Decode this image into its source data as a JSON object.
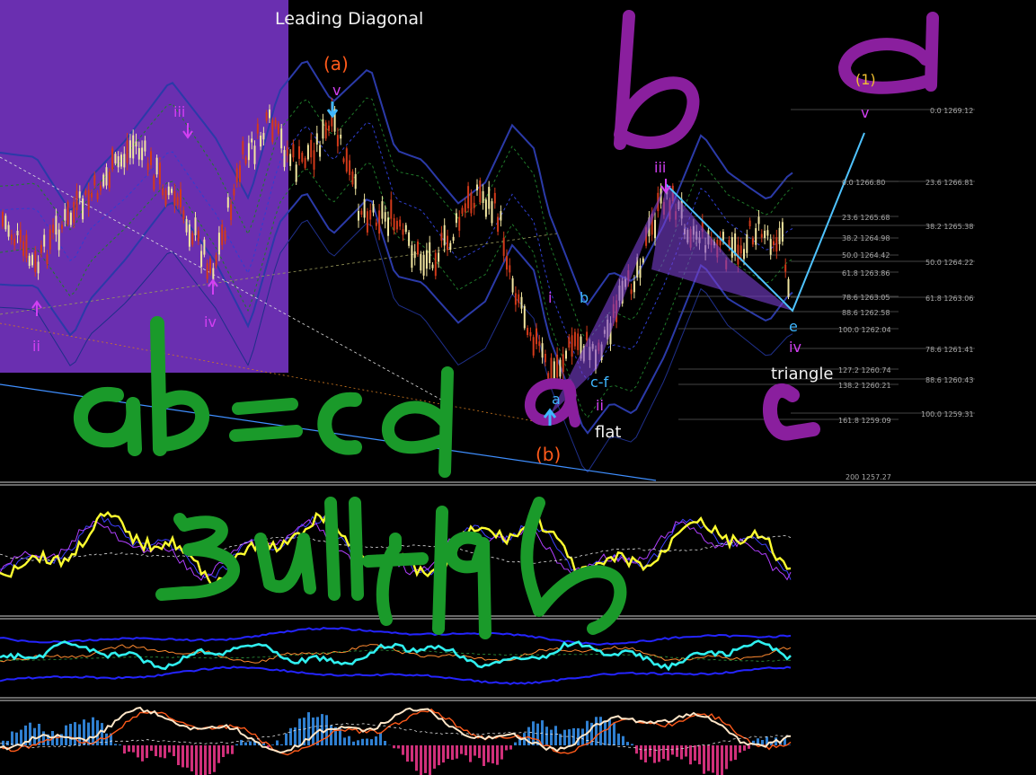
{
  "chart_data": {
    "type": "candlestick",
    "title": "Leading Diagonal",
    "colors": {
      "background": "#000000",
      "bull_candle": "#f2e6a0",
      "bear_candle": "#d33a1a",
      "overlay_box": "#6a2fb0",
      "wave_magenta": "#d23ff2",
      "wave_cyan": "#3fb7ff",
      "wave_orange": "#ff5a1a",
      "wave_yellow": "#f0c030",
      "marker_purple": "#7b1fa2",
      "marker_green": "#1a9a2a",
      "fib_text": "#b8b8b8",
      "osc_yellow": "#ffff30",
      "osc_cyan": "#30f0f0",
      "osc_orange": "#ff8a30",
      "hist_blue": "#2f7fd0",
      "hist_pink": "#d0307a"
    },
    "labels": {
      "leading_diagonal": "Leading Diagonal",
      "wave_a_top": "(a)",
      "wave_b_bottom": "(b)",
      "wave_1_top": "(1)",
      "roman_ii_left": "ii",
      "roman_iii_left": "iii",
      "roman_iv_left": "iv",
      "roman_v_top": "v",
      "roman_i_mid": "i",
      "wave_b_small": "b",
      "wave_a_small": "a",
      "wave_cf": "c-f",
      "roman_ii_mid": "ii",
      "flat": "flat",
      "roman_iii_right": "iii",
      "wave_e": "e",
      "roman_iv_right": "iv",
      "triangle": "triangle",
      "roman_v_right": "v"
    },
    "fib_levels_left": [
      "0.0 1266.80",
      "23.6 1265.68",
      "38.2 1264.98",
      "50.0 1264.42",
      "61.8 1263.86",
      "78.6 1263.05",
      "88.6 1262.58",
      "100.0 1262.04",
      "127.2 1260.74",
      "138.2 1260.21",
      "161.8 1259.09",
      "200 1257.27"
    ],
    "fib_levels_right": [
      "0.0 1269.12",
      "23.6 1266.81",
      "38.2 1265.38",
      "50.0 1264.22",
      "61.8 1263.06",
      "78.6 1261.41",
      "88.6 1260.43",
      "100.0 1259.31"
    ],
    "handwriting": {
      "top_b": "b",
      "top_d": "d",
      "left_abcd": "ab=cd",
      "bottom_c": "c",
      "bull_flag": "Bull flag",
      "circle_a": "a"
    }
  }
}
